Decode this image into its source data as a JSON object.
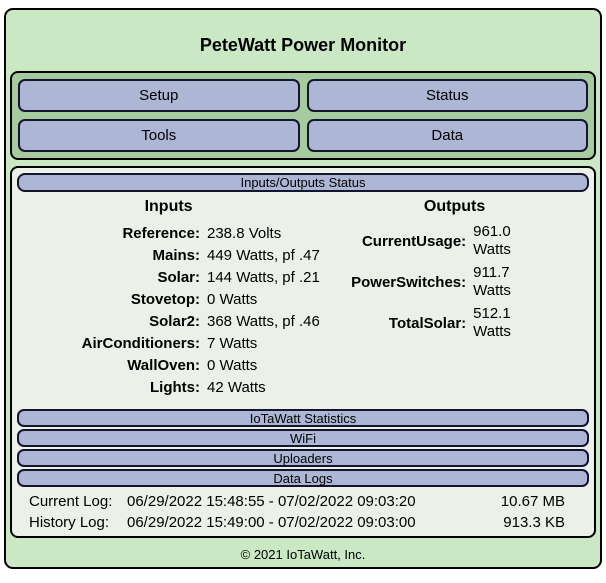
{
  "title": "PeteWatt Power Monitor",
  "menu": {
    "buttons": [
      {
        "label": "Setup"
      },
      {
        "label": "Status"
      },
      {
        "label": "Tools"
      },
      {
        "label": "Data"
      }
    ]
  },
  "status": {
    "header": "Inputs/Outputs Status",
    "inputs_heading": "Inputs",
    "outputs_heading": "Outputs",
    "inputs": [
      {
        "label": "Reference:",
        "value": "238.8 Volts"
      },
      {
        "label": "Mains:",
        "value": "449 Watts, pf .47"
      },
      {
        "label": "Solar:",
        "value": "144 Watts, pf .21"
      },
      {
        "label": "Stovetop:",
        "value": "0 Watts"
      },
      {
        "label": "Solar2:",
        "value": "368 Watts, pf .46"
      },
      {
        "label": "AirConditioners:",
        "value": "7 Watts"
      },
      {
        "label": "WallOven:",
        "value": "0 Watts"
      },
      {
        "label": "Lights:",
        "value": "42 Watts"
      }
    ],
    "outputs": [
      {
        "label": "CurrentUsage:",
        "value": "961.0 Watts"
      },
      {
        "label": "PowerSwitches:",
        "value": "911.7 Watts"
      },
      {
        "label": "TotalSolar:",
        "value": "512.1 Watts"
      }
    ],
    "section_bars": [
      {
        "label": "IoTaWatt Statistics"
      },
      {
        "label": "WiFi"
      },
      {
        "label": "Uploaders"
      },
      {
        "label": "Data Logs"
      }
    ],
    "logs": [
      {
        "label": "Current Log:",
        "range": "06/29/2022 15:48:55 - 07/02/2022 09:03:20",
        "size": "10.67 MB"
      },
      {
        "label": "History Log:",
        "range": "06/29/2022 15:49:00 - 07/02/2022 09:03:00",
        "size": "913.3 KB"
      }
    ]
  },
  "footer": "© 2021 IoTaWatt, Inc.",
  "colors": {
    "container_green": "#c9e8c3",
    "panel_green": "#a5cb9e",
    "button_fill": "#adb6d4",
    "button_border": "#15152e",
    "status_bg": "#ebf1e8"
  }
}
